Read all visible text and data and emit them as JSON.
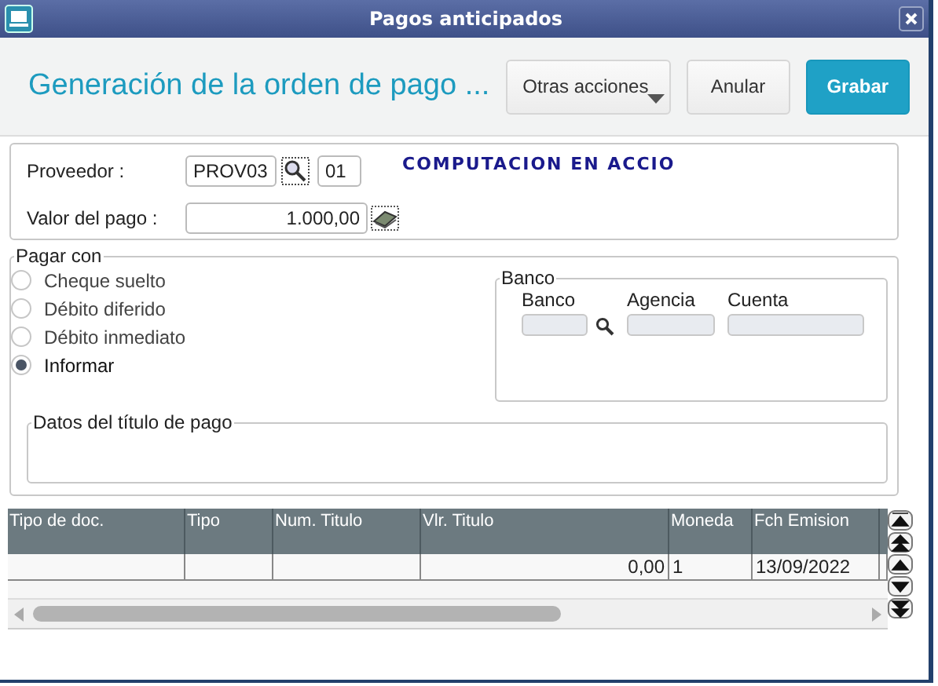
{
  "window": {
    "title": "Pagos anticipados"
  },
  "header": {
    "title": "Generación de la orden de pago ...",
    "buttons": [
      {
        "label": "Otras acciones",
        "kind": "menu"
      },
      {
        "label": "Anular",
        "kind": "plain"
      },
      {
        "label": "Grabar",
        "kind": "primary"
      }
    ]
  },
  "supplier": {
    "label": "Proveedor :",
    "code": "PROV03",
    "branch": "01",
    "name": "COMPUTACION EN ACCIO",
    "amount_label": "Valor del pago :",
    "amount": "1.000,00"
  },
  "pay_with": {
    "legend": "Pagar con",
    "options": [
      {
        "label": "Cheque suelto",
        "selected": false
      },
      {
        "label": "Débito diferido",
        "selected": false
      },
      {
        "label": "Débito inmediato",
        "selected": false
      },
      {
        "label": "Informar",
        "selected": true
      }
    ],
    "bank": {
      "legend": "Banco",
      "fields": [
        "Banco",
        "Agencia",
        "Cuenta"
      ]
    },
    "title_data": {
      "legend": "Datos del título de pago"
    }
  },
  "table": {
    "columns": [
      "Tipo de doc.",
      "Tipo",
      "Num. Titulo",
      "Vlr. Titulo",
      "Moneda",
      "Fch Emision"
    ],
    "rows": [
      [
        "",
        "",
        "",
        "0,00",
        "1",
        "13/09/2022"
      ]
    ]
  }
}
